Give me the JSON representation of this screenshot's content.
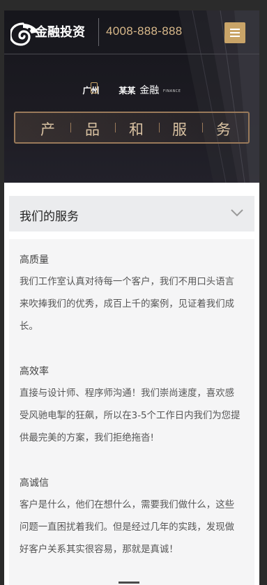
{
  "header": {
    "logo_text": "金融投资",
    "phone": "4008-888-888",
    "menu_icon": "hamburger-icon"
  },
  "banner": {
    "brand_city": "广州",
    "brand_name": "某某",
    "brand_suffix": "金融",
    "brand_en": "FINANCE",
    "title_chars": [
      "产",
      "品",
      "和",
      "服",
      "务"
    ]
  },
  "services": {
    "title": "我们的服务",
    "toggle_icon": "chevron-down-icon",
    "items": [
      {
        "title": "高质量",
        "body": "我们工作室认真对待每一个客户，我们不用口头语言来吹捧我们的优秀，成百上千的案例，见证着我们成长。"
      },
      {
        "title": "高效率",
        "body": "直接与设计师、程序师沟通！我们崇尚速度，喜欢感受风驰电掣的狂飙，所以在3-5个工作日内我们为您提供最完美的方案，我们拒绝拖沓!"
      },
      {
        "title": "高诚信",
        "body": "客户是什么，他们在想什么，需要我们做什么，这些问题一直困扰着我们。但是经过几年的实践，发现做好客户关系其实很容易，那就是真诚！"
      }
    ]
  },
  "colors": {
    "accent_gold": "#c9a468",
    "phone_text": "#d8b88a",
    "banner_bg": "#1c1b22",
    "section_bg": "#ebecee"
  }
}
